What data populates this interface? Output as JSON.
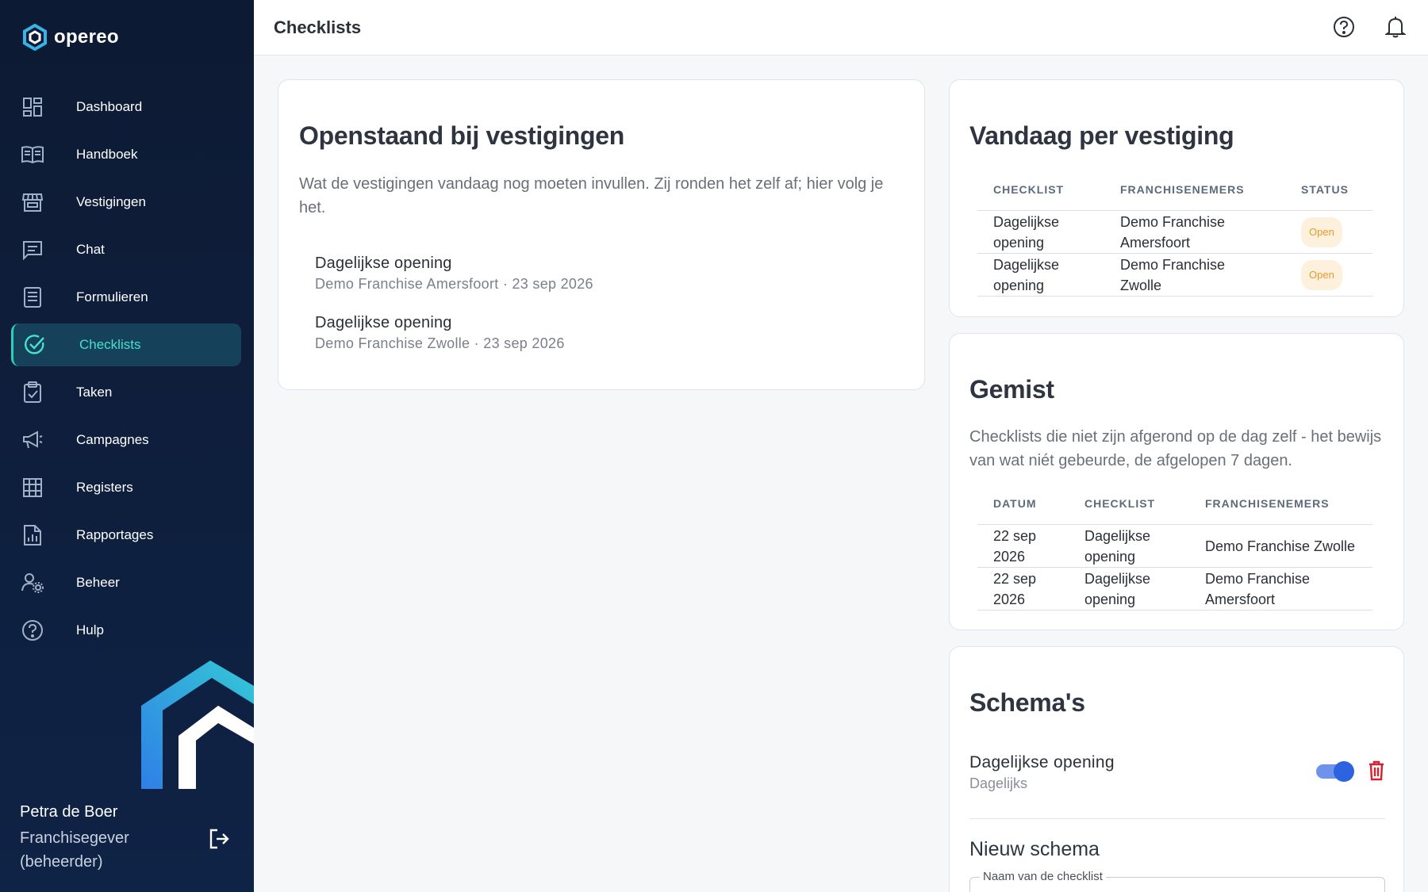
{
  "app": {
    "name": "opereo"
  },
  "sidebar": {
    "items": [
      {
        "label": "Dashboard",
        "icon": "dashboard-icon"
      },
      {
        "label": "Handboek",
        "icon": "book-icon"
      },
      {
        "label": "Vestigingen",
        "icon": "store-icon"
      },
      {
        "label": "Chat",
        "icon": "chat-icon"
      },
      {
        "label": "Formulieren",
        "icon": "form-icon"
      },
      {
        "label": "Checklists",
        "icon": "check-circle-icon",
        "active": true
      },
      {
        "label": "Taken",
        "icon": "clipboard-check-icon"
      },
      {
        "label": "Campagnes",
        "icon": "megaphone-icon"
      },
      {
        "label": "Registers",
        "icon": "grid-icon"
      },
      {
        "label": "Rapportages",
        "icon": "report-icon"
      },
      {
        "label": "Beheer",
        "icon": "user-gear-icon"
      },
      {
        "label": "Hulp",
        "icon": "help-icon"
      }
    ],
    "user": {
      "name": "Petra de Boer",
      "role_line1": "Franchisegever",
      "role_line2": "(beheerder)"
    }
  },
  "header": {
    "title": "Checklists"
  },
  "open_card": {
    "title": "Openstaand bij vestigingen",
    "description": "Wat de vestigingen vandaag nog moeten invullen. Zij ronden het zelf af; hier volg je het.",
    "items": [
      {
        "title": "Dagelijkse opening",
        "subtitle": "Demo Franchise Amersfoort · 23 sep 2026"
      },
      {
        "title": "Dagelijkse opening",
        "subtitle": "Demo Franchise Zwolle · 23 sep 2026"
      }
    ]
  },
  "today_card": {
    "title": "Vandaag per vestiging",
    "columns": [
      "CHECKLIST",
      "FRANCHISENEMERS",
      "STATUS"
    ],
    "rows": [
      {
        "checklist": "Dagelijkse opening",
        "franchise": "Demo Franchise Amersfoort",
        "status": "Open"
      },
      {
        "checklist": "Dagelijkse opening",
        "franchise": "Demo Franchise Zwolle",
        "status": "Open"
      }
    ]
  },
  "missed_card": {
    "title": "Gemist",
    "description": "Checklists die niet zijn afgerond op de dag zelf - het bewijs van wat niét gebeurde, de afgelopen 7 dagen.",
    "columns": [
      "DATUM",
      "CHECKLIST",
      "FRANCHISENEMERS"
    ],
    "rows": [
      {
        "date": "22 sep 2026",
        "checklist": "Dagelijkse opening",
        "franchise": "Demo Franchise Zwolle"
      },
      {
        "date": "22 sep 2026",
        "checklist": "Dagelijkse opening",
        "franchise": "Demo Franchise Amersfoort"
      }
    ]
  },
  "schema_card": {
    "title": "Schema's",
    "schema": {
      "name": "Dagelijkse opening",
      "frequency": "Dagelijks",
      "enabled": true
    },
    "new_title": "Nieuw schema",
    "name_field_label": "Naam van de checklist"
  },
  "colors": {
    "sidebar_bg": "#0d1a33",
    "accent": "#2ccfb8",
    "toggle": "#2d62e0",
    "danger": "#d3212f",
    "badge_text": "#e49b2a"
  }
}
